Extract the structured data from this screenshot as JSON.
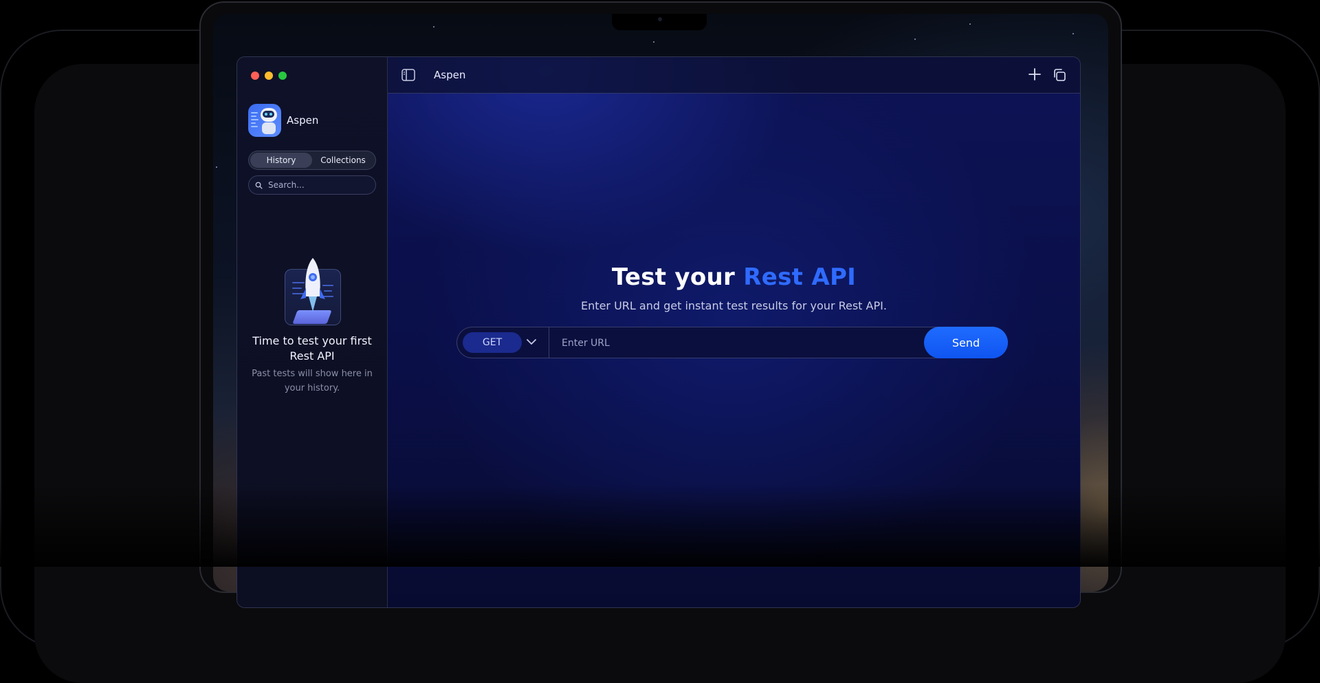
{
  "window": {
    "title": "Aspen"
  },
  "sidebar": {
    "app_name": "Aspen",
    "tabs": [
      {
        "label": "History",
        "active": true
      },
      {
        "label": "Collections",
        "active": false
      }
    ],
    "search": {
      "placeholder": "Search...",
      "value": ""
    },
    "empty_state": {
      "title": "Time to test your first Rest API",
      "subtitle": "Past tests will show here in your history."
    }
  },
  "main": {
    "heading_prefix": "Test your ",
    "heading_accent": "Rest API",
    "subheading": "Enter URL and get instant test results for your Rest API.",
    "request": {
      "method": "GET",
      "url_placeholder": "Enter URL",
      "url_value": "",
      "send_label": "Send"
    }
  },
  "icons": {
    "sidebar_toggle": "sidebar-toggle-icon",
    "new_tab": "plus-icon",
    "duplicate": "copy-icon",
    "search": "search-icon",
    "method_dropdown": "chevron-down-icon",
    "empty_illustration": "rocket-icon"
  },
  "colors": {
    "accent": "#2f6bff",
    "send_button": "#1f6bff",
    "traffic_red": "#ff5f57",
    "traffic_yellow": "#febc2e",
    "traffic_green": "#28c840"
  }
}
